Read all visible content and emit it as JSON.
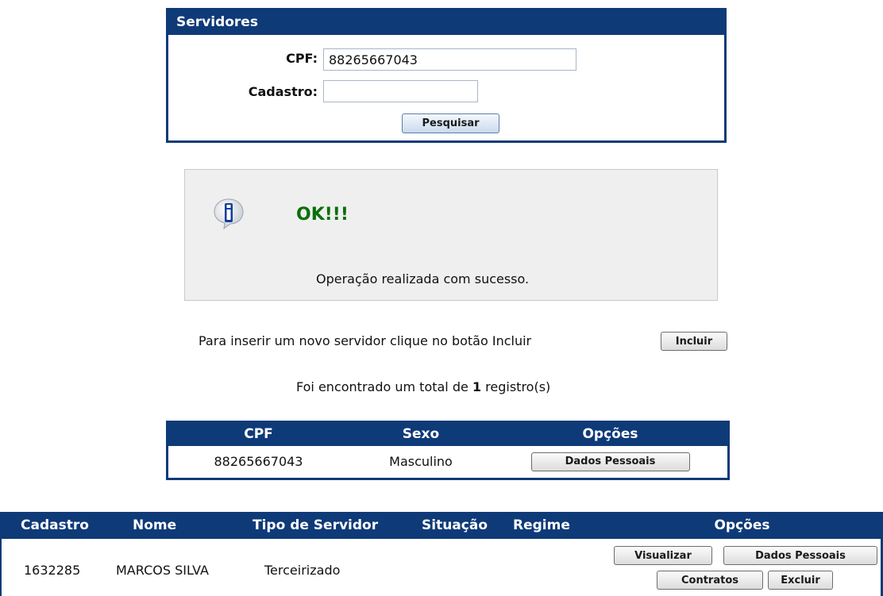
{
  "search": {
    "title": "Servidores",
    "cpf_label": "CPF:",
    "cpf_value": "88265667043",
    "cadastro_label": "Cadastro:",
    "cadastro_value": "",
    "search_button": "Pesquisar"
  },
  "message": {
    "icon": "info-icon",
    "title": "OK!!!",
    "text": "Operação realizada com sucesso."
  },
  "include": {
    "text": "Para inserir um novo servidor clique no botão Incluir",
    "button": "Incluir"
  },
  "results": {
    "prefix": "Foi encontrado um total de",
    "count": "1",
    "suffix": "registro(s)"
  },
  "cpf_table": {
    "headers": [
      "CPF",
      "Sexo",
      "Opções"
    ],
    "rows": [
      {
        "cpf": "88265667043",
        "sexo": "Masculino",
        "button": "Dados Pessoais"
      }
    ]
  },
  "servidor_table": {
    "headers": [
      "Cadastro",
      "Nome",
      "Tipo de Servidor",
      "Situação",
      "Regime",
      "Opções"
    ],
    "rows": [
      {
        "cadastro": "1632285",
        "nome": "MARCOS SILVA",
        "tipo": "Terceirizado",
        "situacao": "",
        "regime": "",
        "buttons": {
          "visualizar": "Visualizar",
          "dados_pessoais": "Dados Pessoais",
          "contratos": "Contratos",
          "excluir": "Excluir"
        }
      }
    ]
  },
  "colors": {
    "header_bg": "#0f3a78",
    "ok_green": "#0a6f0a",
    "message_bg": "#efefef"
  }
}
